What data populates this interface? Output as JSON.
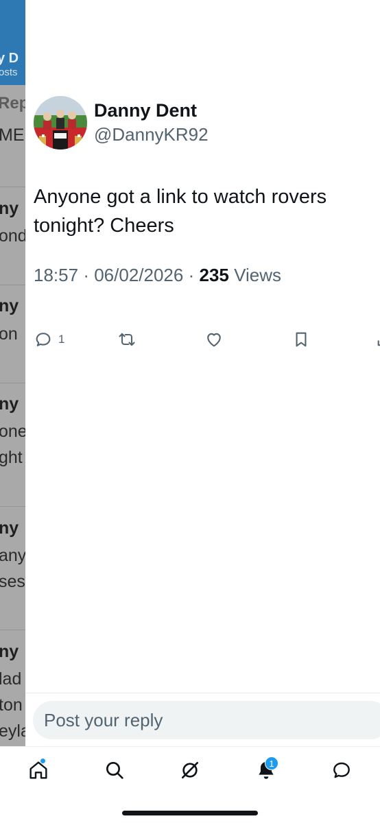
{
  "background_profile": {
    "name_fragment": "y D",
    "sub_fragment": "osts",
    "tab_fragment": "Rep",
    "lines": [
      {
        "text": "ME I",
        "bold": false
      },
      {
        "text": "ny",
        "bold": true
      },
      {
        "text": "ond",
        "bold": false
      },
      {
        "text": "ny",
        "bold": true
      },
      {
        "text": "on",
        "bold": false
      },
      {
        "text": "ny",
        "bold": true
      },
      {
        "text": "one",
        "bold": false
      },
      {
        "text": "ght",
        "bold": false
      },
      {
        "text": "ny",
        "bold": true
      },
      {
        "text": "any",
        "bold": false
      },
      {
        "text": "ses",
        "bold": false
      },
      {
        "text": "ny",
        "bold": true
      },
      {
        "text": "lad",
        "bold": false
      },
      {
        "text": "ton",
        "bold": false
      },
      {
        "text": "eyla",
        "bold": false
      }
    ]
  },
  "post": {
    "author_name": "Danny Dent",
    "author_handle": "@DannyKR92",
    "text": "Anyone got a link to watch rovers tonight? Cheers",
    "time": "18:57",
    "date": "06/02/2026",
    "separator": "·",
    "views_count": "235",
    "views_label": "Views",
    "reply_count": "1"
  },
  "reply": {
    "placeholder": "Post your reply"
  },
  "nav": {
    "notifications_badge": "1"
  },
  "colors": {
    "accent": "#1d9bf0",
    "secondary_text": "#536471",
    "profile_header": "#2e79b3"
  }
}
